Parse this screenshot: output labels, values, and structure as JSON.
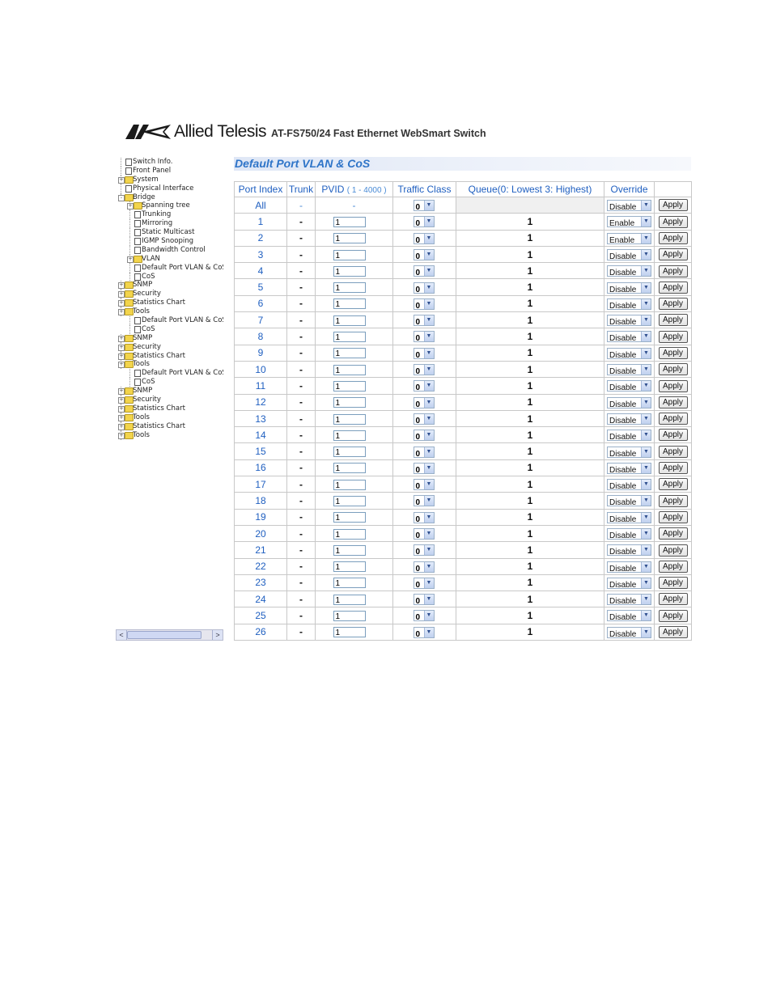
{
  "header": {
    "brand": "Allied Telesis",
    "product": "AT-FS750/24 Fast Ethernet WebSmart Switch",
    "logo_icon": "allied-telesis-logo-icon",
    "logo_color": "#1a1a1a"
  },
  "tree": [
    {
      "label": "Switch Info.",
      "type": "page",
      "depth": 0
    },
    {
      "label": "Front Panel",
      "type": "page",
      "depth": 0
    },
    {
      "label": "System",
      "type": "folder",
      "depth": 0,
      "expander": "+"
    },
    {
      "label": "Physical Interface",
      "type": "page",
      "depth": 0
    },
    {
      "label": "Bridge",
      "type": "folder",
      "depth": 0,
      "expander": "-"
    },
    {
      "label": "Spanning tree",
      "type": "folder",
      "depth": 1,
      "expander": "+"
    },
    {
      "label": "Trunking",
      "type": "page",
      "depth": 1
    },
    {
      "label": "Mirroring",
      "type": "page",
      "depth": 1
    },
    {
      "label": "Static Multicast",
      "type": "page",
      "depth": 1
    },
    {
      "label": "IGMP Snooping",
      "type": "page",
      "depth": 1
    },
    {
      "label": "Bandwidth Control",
      "type": "page",
      "depth": 1
    },
    {
      "label": "VLAN",
      "type": "folder",
      "depth": 1,
      "expander": "+"
    },
    {
      "label": "Default Port VLAN & CoS",
      "type": "page",
      "depth": 1
    },
    {
      "label": "CoS",
      "type": "page",
      "depth": 1
    },
    {
      "label": "SNMP",
      "type": "folder",
      "depth": 0,
      "expander": "+"
    },
    {
      "label": "Security",
      "type": "folder",
      "depth": 0,
      "expander": "+"
    },
    {
      "label": "Statistics Chart",
      "type": "folder",
      "depth": 0,
      "expander": "+"
    },
    {
      "label": "Tools",
      "type": "folder",
      "depth": 0,
      "expander": "+"
    },
    {
      "label": "Default Port VLAN & CoS",
      "type": "page",
      "depth": 1
    },
    {
      "label": "CoS",
      "type": "page",
      "depth": 1
    },
    {
      "label": "SNMP",
      "type": "folder",
      "depth": 0,
      "expander": "+"
    },
    {
      "label": "Security",
      "type": "folder",
      "depth": 0,
      "expander": "+"
    },
    {
      "label": "Statistics Chart",
      "type": "folder",
      "depth": 0,
      "expander": "+"
    },
    {
      "label": "Tools",
      "type": "folder",
      "depth": 0,
      "expander": "+"
    },
    {
      "label": "Default Port VLAN & CoS",
      "type": "page",
      "depth": 1
    },
    {
      "label": "CoS",
      "type": "page",
      "depth": 1
    },
    {
      "label": "SNMP",
      "type": "folder",
      "depth": 0,
      "expander": "+"
    },
    {
      "label": "Security",
      "type": "folder",
      "depth": 0,
      "expander": "+"
    },
    {
      "label": "Statistics Chart",
      "type": "folder",
      "depth": 0,
      "expander": "+"
    },
    {
      "label": "Tools",
      "type": "folder",
      "depth": 0,
      "expander": "+"
    },
    {
      "label": "Statistics Chart",
      "type": "folder",
      "depth": 0,
      "expander": "+"
    },
    {
      "label": "Tools",
      "type": "folder",
      "depth": 0,
      "expander": "+"
    }
  ],
  "scrollbar": {
    "left_arrow": "<",
    "right_arrow": ">"
  },
  "main": {
    "title": "Default Port VLAN & CoS",
    "headers": {
      "port_index": "Port Index",
      "trunk": "Trunk",
      "pvid": "PVID",
      "pvid_range": "( 1 - 4000 )",
      "traffic_class": "Traffic Class",
      "queue": "Queue(0: Lowest  3: Highest)",
      "override": "Override"
    },
    "all_row": {
      "port": "All",
      "trunk": "-",
      "pvid": "-",
      "traffic_class": "0",
      "override": "Disable",
      "apply": "Apply"
    },
    "rows": [
      {
        "port": "1",
        "trunk": "-",
        "pvid": "1",
        "traffic_class": "0",
        "queue": "1",
        "override": "Enable",
        "apply": "Apply"
      },
      {
        "port": "2",
        "trunk": "-",
        "pvid": "1",
        "traffic_class": "0",
        "queue": "1",
        "override": "Enable",
        "apply": "Apply"
      },
      {
        "port": "3",
        "trunk": "-",
        "pvid": "1",
        "traffic_class": "0",
        "queue": "1",
        "override": "Disable",
        "apply": "Apply"
      },
      {
        "port": "4",
        "trunk": "-",
        "pvid": "1",
        "traffic_class": "0",
        "queue": "1",
        "override": "Disable",
        "apply": "Apply"
      },
      {
        "port": "5",
        "trunk": "-",
        "pvid": "1",
        "traffic_class": "0",
        "queue": "1",
        "override": "Disable",
        "apply": "Apply"
      },
      {
        "port": "6",
        "trunk": "-",
        "pvid": "1",
        "traffic_class": "0",
        "queue": "1",
        "override": "Disable",
        "apply": "Apply"
      },
      {
        "port": "7",
        "trunk": "-",
        "pvid": "1",
        "traffic_class": "0",
        "queue": "1",
        "override": "Disable",
        "apply": "Apply"
      },
      {
        "port": "8",
        "trunk": "-",
        "pvid": "1",
        "traffic_class": "0",
        "queue": "1",
        "override": "Disable",
        "apply": "Apply"
      },
      {
        "port": "9",
        "trunk": "-",
        "pvid": "1",
        "traffic_class": "0",
        "queue": "1",
        "override": "Disable",
        "apply": "Apply"
      },
      {
        "port": "10",
        "trunk": "-",
        "pvid": "1",
        "traffic_class": "0",
        "queue": "1",
        "override": "Disable",
        "apply": "Apply"
      },
      {
        "port": "11",
        "trunk": "-",
        "pvid": "1",
        "traffic_class": "0",
        "queue": "1",
        "override": "Disable",
        "apply": "Apply"
      },
      {
        "port": "12",
        "trunk": "-",
        "pvid": "1",
        "traffic_class": "0",
        "queue": "1",
        "override": "Disable",
        "apply": "Apply"
      },
      {
        "port": "13",
        "trunk": "-",
        "pvid": "1",
        "traffic_class": "0",
        "queue": "1",
        "override": "Disable",
        "apply": "Apply"
      },
      {
        "port": "14",
        "trunk": "-",
        "pvid": "1",
        "traffic_class": "0",
        "queue": "1",
        "override": "Disable",
        "apply": "Apply"
      },
      {
        "port": "15",
        "trunk": "-",
        "pvid": "1",
        "traffic_class": "0",
        "queue": "1",
        "override": "Disable",
        "apply": "Apply"
      },
      {
        "port": "16",
        "trunk": "-",
        "pvid": "1",
        "traffic_class": "0",
        "queue": "1",
        "override": "Disable",
        "apply": "Apply"
      },
      {
        "port": "17",
        "trunk": "-",
        "pvid": "1",
        "traffic_class": "0",
        "queue": "1",
        "override": "Disable",
        "apply": "Apply"
      },
      {
        "port": "18",
        "trunk": "-",
        "pvid": "1",
        "traffic_class": "0",
        "queue": "1",
        "override": "Disable",
        "apply": "Apply"
      },
      {
        "port": "19",
        "trunk": "-",
        "pvid": "1",
        "traffic_class": "0",
        "queue": "1",
        "override": "Disable",
        "apply": "Apply"
      },
      {
        "port": "20",
        "trunk": "-",
        "pvid": "1",
        "traffic_class": "0",
        "queue": "1",
        "override": "Disable",
        "apply": "Apply"
      },
      {
        "port": "21",
        "trunk": "-",
        "pvid": "1",
        "traffic_class": "0",
        "queue": "1",
        "override": "Disable",
        "apply": "Apply"
      },
      {
        "port": "22",
        "trunk": "-",
        "pvid": "1",
        "traffic_class": "0",
        "queue": "1",
        "override": "Disable",
        "apply": "Apply"
      },
      {
        "port": "23",
        "trunk": "-",
        "pvid": "1",
        "traffic_class": "0",
        "queue": "1",
        "override": "Disable",
        "apply": "Apply"
      },
      {
        "port": "24",
        "trunk": "-",
        "pvid": "1",
        "traffic_class": "0",
        "queue": "1",
        "override": "Disable",
        "apply": "Apply"
      },
      {
        "port": "25",
        "trunk": "-",
        "pvid": "1",
        "traffic_class": "0",
        "queue": "1",
        "override": "Disable",
        "apply": "Apply"
      },
      {
        "port": "26",
        "trunk": "-",
        "pvid": "1",
        "traffic_class": "0",
        "queue": "1",
        "override": "Disable",
        "apply": "Apply"
      }
    ]
  },
  "colors": {
    "header_text": "#1f5fc0",
    "title_text": "#2e74c8",
    "title_bar": "#dfe7f6",
    "grid": "#c8c8c8"
  }
}
